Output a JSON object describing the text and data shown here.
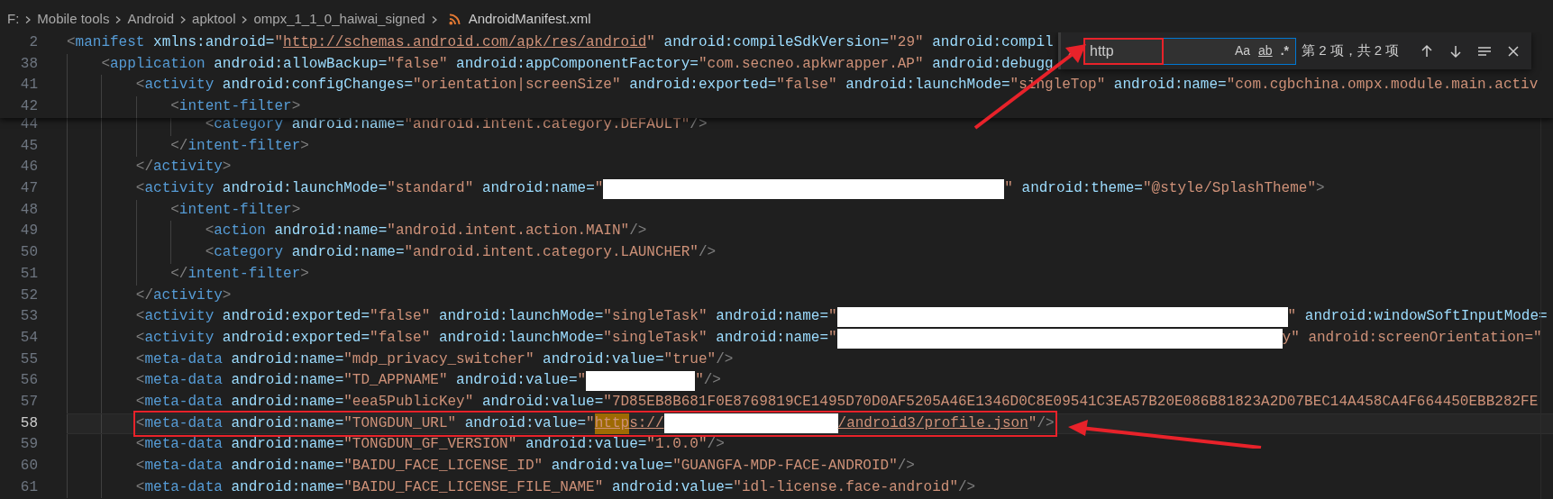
{
  "breadcrumb": [
    {
      "label": "F:",
      "kind": "folder"
    },
    {
      "label": "Mobile tools",
      "kind": "folder"
    },
    {
      "label": "Android",
      "kind": "folder"
    },
    {
      "label": "apktool",
      "kind": "folder"
    },
    {
      "label": "ompx_1_1_0_haiwai_signed",
      "kind": "folder"
    },
    {
      "label": "AndroidManifest.xml",
      "kind": "file"
    }
  ],
  "sticky_scroll": [
    {
      "number": "2",
      "current": false,
      "annotated": false,
      "segments": [
        {
          "kind": "code",
          "text": "<manifest xmlns:android=\""
        },
        {
          "kind": "link",
          "text": "http://schemas.android.com/apk/res/android"
        },
        {
          "kind": "code",
          "text": "\" android:compileSdkVersion=\"29\" android:compil"
        }
      ]
    },
    {
      "number": "38",
      "current": false,
      "annotated": false,
      "segments": [
        {
          "kind": "code",
          "text": "    <application android:allowBackup=\"false\" android:appComponentFactory=\"com.secneo.apkwrapper.AP\" android:debugg"
        }
      ]
    },
    {
      "number": "41",
      "current": false,
      "annotated": false,
      "segments": [
        {
          "kind": "code",
          "text": "        <activity android:configChanges=\"orientation|screenSize\" android:exported=\"false\" android:launchMode=\"singleTop\" android:name=\"com.cgbchina.ompx.module.main.activ"
        }
      ]
    },
    {
      "number": "42",
      "current": false,
      "annotated": false,
      "segments": [
        {
          "kind": "code",
          "text": "            <intent-filter>"
        }
      ]
    }
  ],
  "lines": [
    {
      "number": "44",
      "current": false,
      "annotated": false,
      "segments": [
        {
          "kind": "code",
          "text": "                <category android:name=\"android.intent.category.DEFAULT\"/>"
        }
      ]
    },
    {
      "number": "45",
      "current": false,
      "annotated": false,
      "segments": [
        {
          "kind": "code",
          "text": "            </intent-filter>"
        }
      ]
    },
    {
      "number": "46",
      "current": false,
      "annotated": false,
      "segments": [
        {
          "kind": "code",
          "text": "        </activity>"
        }
      ]
    },
    {
      "number": "47",
      "current": false,
      "annotated": false,
      "segments": [
        {
          "kind": "code",
          "text": "        <activity android:launchMode=\"standard\" android:name=\""
        },
        {
          "kind": "redacted"
        },
        {
          "kind": "code",
          "text": "\" android:theme=\"@style/SplashTheme\">"
        }
      ]
    },
    {
      "number": "48",
      "current": false,
      "annotated": false,
      "segments": [
        {
          "kind": "code",
          "text": "            <intent-filter>"
        }
      ]
    },
    {
      "number": "49",
      "current": false,
      "annotated": false,
      "segments": [
        {
          "kind": "code",
          "text": "                <action android:name=\"android.intent.action.MAIN\"/>"
        }
      ]
    },
    {
      "number": "50",
      "current": false,
      "annotated": false,
      "segments": [
        {
          "kind": "code",
          "text": "                <category android:name=\"android.intent.category.LAUNCHER\"/>"
        }
      ]
    },
    {
      "number": "51",
      "current": false,
      "annotated": false,
      "segments": [
        {
          "kind": "code",
          "text": "            </intent-filter>"
        }
      ]
    },
    {
      "number": "52",
      "current": false,
      "annotated": false,
      "segments": [
        {
          "kind": "code",
          "text": "        </activity>"
        }
      ]
    },
    {
      "number": "53",
      "current": false,
      "annotated": false,
      "segments": [
        {
          "kind": "code",
          "text": "        <activity android:exported=\"false\" android:launchMode=\"singleTask\" android:name=\""
        },
        {
          "kind": "redacted"
        },
        {
          "kind": "code",
          "text": "\" android:windowSoftInputMode="
        }
      ]
    },
    {
      "number": "54",
      "current": false,
      "annotated": false,
      "segments": [
        {
          "kind": "code",
          "text": "        <activity android:exported=\"false\" android:launchMode=\"singleTask\" android:name=\""
        },
        {
          "kind": "redacted"
        },
        {
          "kind": "string",
          "text": "y\""
        },
        {
          "kind": "code",
          "text": " android:screenOrientation=\""
        }
      ]
    },
    {
      "number": "55",
      "current": false,
      "annotated": false,
      "segments": [
        {
          "kind": "code",
          "text": "        <meta-data android:name=\"mdp_privacy_switcher\" android:value=\"true\"/>"
        }
      ]
    },
    {
      "number": "56",
      "current": false,
      "annotated": false,
      "segments": [
        {
          "kind": "code",
          "text": "        <meta-data android:name=\"TD_APPNAME\" android:value=\""
        },
        {
          "kind": "redacted"
        },
        {
          "kind": "code",
          "text": "\"/>"
        }
      ]
    },
    {
      "number": "57",
      "current": false,
      "annotated": false,
      "segments": [
        {
          "kind": "code",
          "text": "        <meta-data android:name=\"eea5PublicKey\" android:value=\"7D85EB8B681F0E8769819CE1495D70D0AF5205A46E1346D0C8E09541C3EA57B20E086B81823A2D07BEC14A458CA4F664450EBB282FE"
        }
      ]
    },
    {
      "number": "58",
      "current": true,
      "annotated": true,
      "segments": [
        {
          "kind": "code",
          "text": "        <meta-data android:name=\"TONGDUN_URL\" android:value=\""
        },
        {
          "kind": "match",
          "text": "http"
        },
        {
          "kind": "link",
          "text": "s://"
        },
        {
          "kind": "redacted"
        },
        {
          "kind": "link",
          "text": "/android3/profile.json"
        },
        {
          "kind": "code",
          "text": "\"/>"
        }
      ]
    },
    {
      "number": "59",
      "current": false,
      "annotated": false,
      "segments": [
        {
          "kind": "code",
          "text": "        <meta-data android:name=\"TONGDUN_GF_VERSION\" android:value=\"1.0.0\"/>"
        }
      ]
    },
    {
      "number": "60",
      "current": false,
      "annotated": false,
      "segments": [
        {
          "kind": "code",
          "text": "        <meta-data android:name=\"BAIDU_FACE_LICENSE_ID\" android:value=\"GUANGFA-MDP-FACE-ANDROID\"/>"
        }
      ]
    },
    {
      "number": "61",
      "current": false,
      "annotated": false,
      "segments": [
        {
          "kind": "code",
          "text": "        <meta-data android:name=\"BAIDU_FACE_LICENSE_FILE_NAME\" android:value=\"idl-license.face-android\"/>"
        }
      ]
    }
  ],
  "find": {
    "replace_expanded": false,
    "query": "http",
    "annotated": true,
    "options": [
      {
        "label": "Aa",
        "kind": "case",
        "on": false
      },
      {
        "label": "ab",
        "kind": "word",
        "on": false
      },
      {
        "label": ".*",
        "kind": "regex",
        "on": false
      }
    ],
    "result": "第 2 项，共 2 项"
  }
}
